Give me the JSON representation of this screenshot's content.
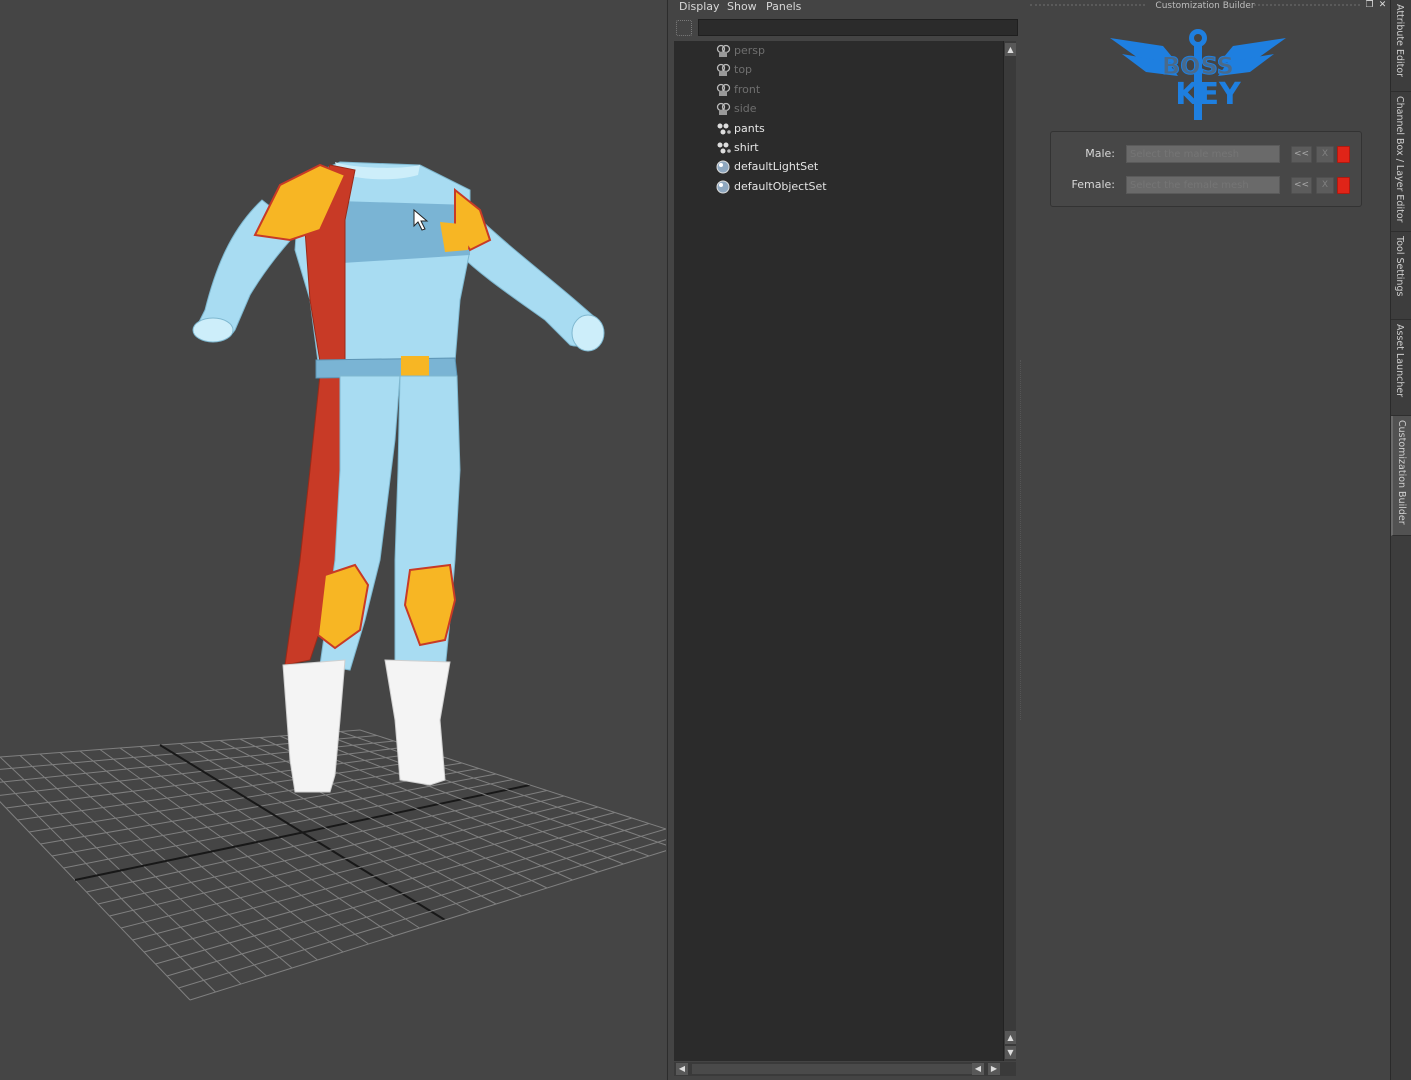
{
  "viewport": {
    "description_hidden": ""
  },
  "outliner": {
    "menu": [
      "Display",
      "Show",
      "Panels"
    ],
    "filter_value": "",
    "items": [
      {
        "label": "persp",
        "icon": "camera-icon",
        "dim": true
      },
      {
        "label": "top",
        "icon": "camera-icon",
        "dim": true
      },
      {
        "label": "front",
        "icon": "camera-icon",
        "dim": true
      },
      {
        "label": "side",
        "icon": "camera-icon",
        "dim": true
      },
      {
        "label": "pants",
        "icon": "mesh-group-icon",
        "dim": false
      },
      {
        "label": "shirt",
        "icon": "mesh-group-icon",
        "dim": false
      },
      {
        "label": "defaultLightSet",
        "icon": "set-icon",
        "dim": false
      },
      {
        "label": "defaultObjectSet",
        "icon": "set-icon",
        "dim": false
      }
    ]
  },
  "builder": {
    "title": "Customization Builder",
    "logo_line1": "BOSS",
    "logo_line2": "KEY",
    "logo_color": "#1e7fe0",
    "rows": [
      {
        "label": "Male:",
        "placeholder": "Select the male mesh",
        "add_label": "<<",
        "clear_label": "X"
      },
      {
        "label": "Female:",
        "placeholder": "Select the female mesh",
        "add_label": "<<",
        "clear_label": "X"
      }
    ]
  },
  "dock_tabs": [
    "Attribute Editor",
    "Channel Box / Layer Editor",
    "Tool Settings",
    "Asset Launcher",
    "Customization Builder"
  ],
  "colors": {
    "suit_light_blue": "#a8dcf2",
    "suit_red": "#c83a26",
    "suit_yellow": "#f7b624",
    "boots": "#f4f4f4"
  }
}
